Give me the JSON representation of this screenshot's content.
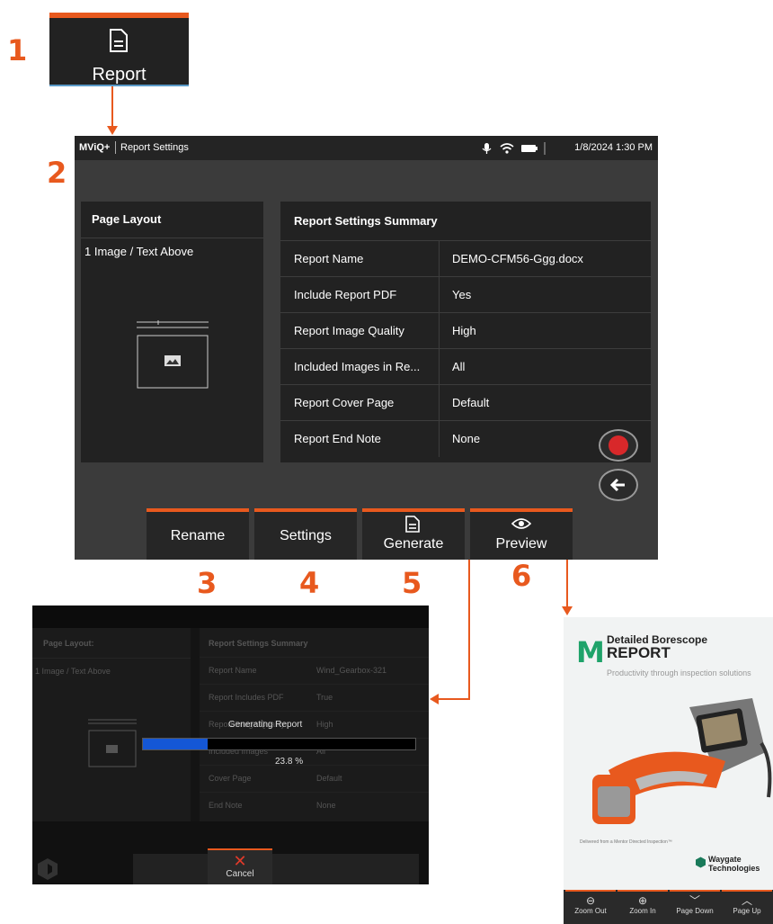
{
  "steps": [
    "1",
    "2",
    "3",
    "4",
    "5",
    "6"
  ],
  "report_button": {
    "label": "Report"
  },
  "status_bar": {
    "brand": "MViQ+",
    "title": "Report Settings",
    "datetime": "1/8/2024 1:30 PM"
  },
  "page_layout": {
    "header": "Page Layout",
    "value": "1 Image / Text Above"
  },
  "summary": {
    "header": "Report Settings Summary",
    "rows": [
      {
        "key": "Report Name",
        "value": "DEMO-CFM56-Ggg.docx"
      },
      {
        "key": "Include Report PDF",
        "value": "Yes"
      },
      {
        "key": "Report Image Quality",
        "value": "High"
      },
      {
        "key": "Included Images in Re...",
        "value": "All"
      },
      {
        "key": "Report Cover Page",
        "value": "Default"
      },
      {
        "key": "Report End Note",
        "value": "None"
      }
    ]
  },
  "buttons": {
    "rename": "Rename",
    "settings": "Settings",
    "generate": "Generate",
    "preview": "Preview"
  },
  "generating": {
    "layout_header": "Page Layout:",
    "layout_value": "1 Image / Text Above",
    "summary_header": "Report Settings Summary",
    "rows": [
      {
        "key": "Report Name",
        "value": "Wind_Gearbox-321"
      },
      {
        "key": "Report Includes PDF",
        "value": "True"
      },
      {
        "key": "Report Image Quality",
        "value": "High"
      },
      {
        "key": "Included Images",
        "value": "All"
      },
      {
        "key": "Cover Page",
        "value": "Default"
      },
      {
        "key": "End Note",
        "value": "None"
      }
    ],
    "progress_title": "Generating Report",
    "progress_fraction": 0.238,
    "progress_text": "23.8 %",
    "cancel": "Cancel"
  },
  "cover": {
    "logo_letter": "M",
    "title_line1": "Detailed Borescope",
    "title_line2": "REPORT",
    "subtitle": "Productivity through inspection solutions",
    "delivered": "Delivered from a Mentor Directed Inspection™",
    "brand_line1": "Waygate",
    "brand_line2": "Technologies",
    "nav": [
      "Zoom Out",
      "Zoom In",
      "Page Down",
      "Page Up"
    ]
  },
  "colors": {
    "accent": "#e8591e",
    "record": "#d8282a",
    "progress": "#1457d6",
    "cover_logo": "#1fa36a"
  }
}
